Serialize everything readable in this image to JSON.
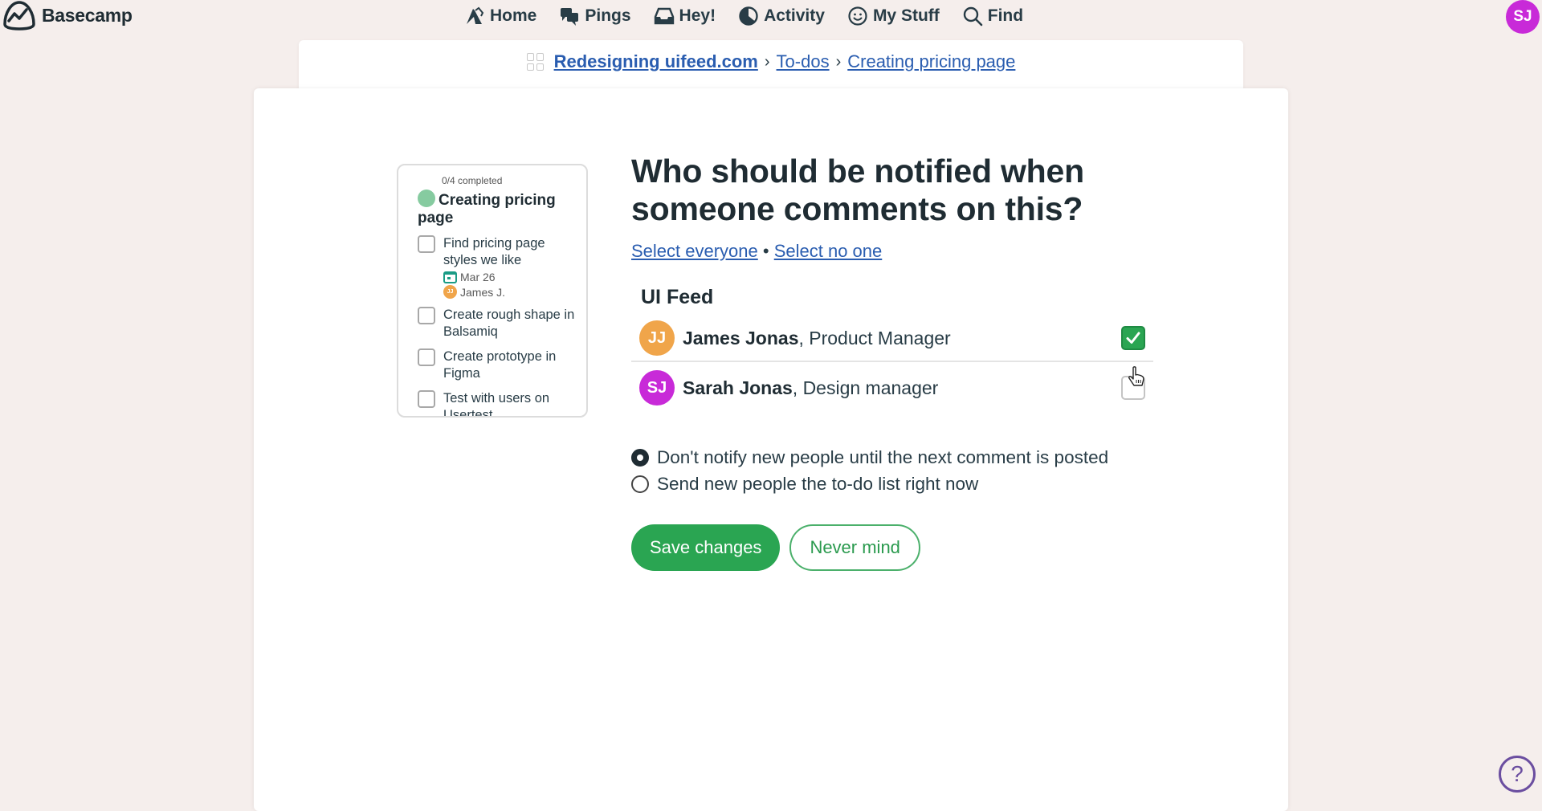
{
  "app": {
    "name": "Basecamp",
    "accent_color": "#2aa552",
    "link_color": "#2a5db0"
  },
  "nav": {
    "items": [
      {
        "label": "Home",
        "icon": "home-icon"
      },
      {
        "label": "Pings",
        "icon": "pings-icon"
      },
      {
        "label": "Hey!",
        "icon": "hey-inbox-icon"
      },
      {
        "label": "Activity",
        "icon": "activity-icon"
      },
      {
        "label": "My Stuff",
        "icon": "my-stuff-icon"
      },
      {
        "label": "Find",
        "icon": "search-icon"
      }
    ],
    "user_initials": "SJ",
    "user_color": "#c82ad8"
  },
  "breadcrumb": {
    "project": "Redesigning uifeed.com",
    "section": "To-dos",
    "current": "Creating pricing page",
    "separator": "›"
  },
  "todo_preview": {
    "completed": "0/4 completed",
    "title": "Creating pricing page",
    "items": [
      {
        "text": "Find pricing page styles we like",
        "due": "Mar 26",
        "assignee": "James J.",
        "assignee_initials": "JJ",
        "checked": false
      },
      {
        "text": "Create rough shape in Balsamiq",
        "checked": false
      },
      {
        "text": "Create prototype in Figma",
        "checked": false
      },
      {
        "text": "Test with users on Usertest",
        "checked": false
      }
    ]
  },
  "form": {
    "heading": "Who should be notified when someone comments on this?",
    "select_everyone": "Select everyone",
    "select_separator": "•",
    "select_no_one": "Select no one",
    "group_label": "UI Feed",
    "people": [
      {
        "initials": "JJ",
        "name": "James Jonas",
        "role": ", Product Manager",
        "color": "#f0a54a",
        "checked": true
      },
      {
        "initials": "SJ",
        "name": "Sarah Jonas",
        "role": ", Design manager",
        "color": "#c82ad8",
        "checked": false
      }
    ],
    "options": [
      {
        "label": "Don't notify new people until the next comment is posted",
        "selected": true
      },
      {
        "label": "Send new people the to-do list right now",
        "selected": false
      }
    ],
    "save_label": "Save changes",
    "cancel_label": "Never mind"
  },
  "help": {
    "label": "?"
  }
}
